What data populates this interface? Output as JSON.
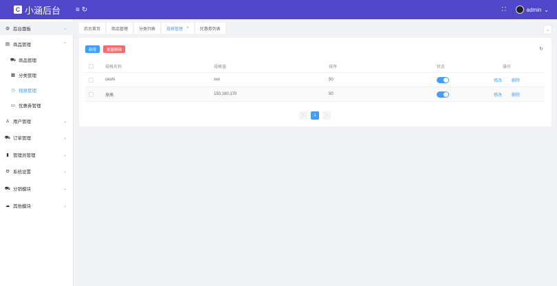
{
  "header": {
    "logo_letter": "C",
    "app_title": "小涵后台",
    "fold_icon": "≡",
    "refresh_icon": "↻",
    "fullscreen_icon": "⛶",
    "username": "admin",
    "user_chevron": "⌄",
    "brand_color": "#4f46c9"
  },
  "sidebar": {
    "items": [
      {
        "label": "后台面板",
        "icon": "dashboard-icon",
        "glyph": "◍",
        "chevron": "⌄"
      },
      {
        "label": "商品管理",
        "icon": "shop-icon",
        "glyph": "▤",
        "chevron": "⌃"
      },
      {
        "label": "商品管理",
        "icon": "cart-icon",
        "glyph": "⛟"
      },
      {
        "label": "分类管理",
        "icon": "grid-icon",
        "glyph": "▦"
      },
      {
        "label": "规格管理",
        "icon": "clock-icon",
        "glyph": "◷"
      },
      {
        "label": "优惠券管理",
        "icon": "ticket-icon",
        "glyph": "▭"
      },
      {
        "label": "用户管理",
        "icon": "user-icon",
        "glyph": "♙",
        "chevron": "⌄"
      },
      {
        "label": "订单管理",
        "icon": "truck-icon",
        "glyph": "⛟",
        "chevron": "⌄"
      },
      {
        "label": "管理员管理",
        "icon": "chart-icon",
        "glyph": "▮",
        "chevron": "⌄"
      },
      {
        "label": "系统设置",
        "icon": "gear-icon",
        "glyph": "⚙",
        "chevron": "⌄"
      },
      {
        "label": "分销模块",
        "icon": "cart-icon",
        "glyph": "⛟",
        "chevron": "⌄"
      },
      {
        "label": "其他模块",
        "icon": "cloud-icon",
        "glyph": "☁",
        "chevron": "⌄"
      }
    ]
  },
  "tabs": [
    {
      "label": "后台首页"
    },
    {
      "label": "商品管理"
    },
    {
      "label": "分类列表"
    },
    {
      "label": "规格管理",
      "close": "×"
    },
    {
      "label": "优惠券列表"
    }
  ],
  "tab_dropdown_icon": "⌄",
  "toolbar": {
    "add_label": "新增",
    "batch_delete_label": "批量删除",
    "refresh_icon": "↻"
  },
  "table": {
    "columns": [
      "规格名称",
      "规格值",
      "排序",
      "状态",
      "操作"
    ],
    "rows": [
      {
        "name": "ceshi",
        "value": "xxx",
        "sort": "50",
        "status": "on",
        "edit": "修改",
        "delete": "删除"
      },
      {
        "name": "身高",
        "value": "150,160,170",
        "sort": "50",
        "status": "on",
        "edit": "修改",
        "delete": "删除"
      }
    ]
  },
  "pagination": {
    "prev": "‹",
    "current": "1",
    "next": "›"
  },
  "colors": {
    "primary": "#409eff",
    "danger": "#f56c6c"
  }
}
